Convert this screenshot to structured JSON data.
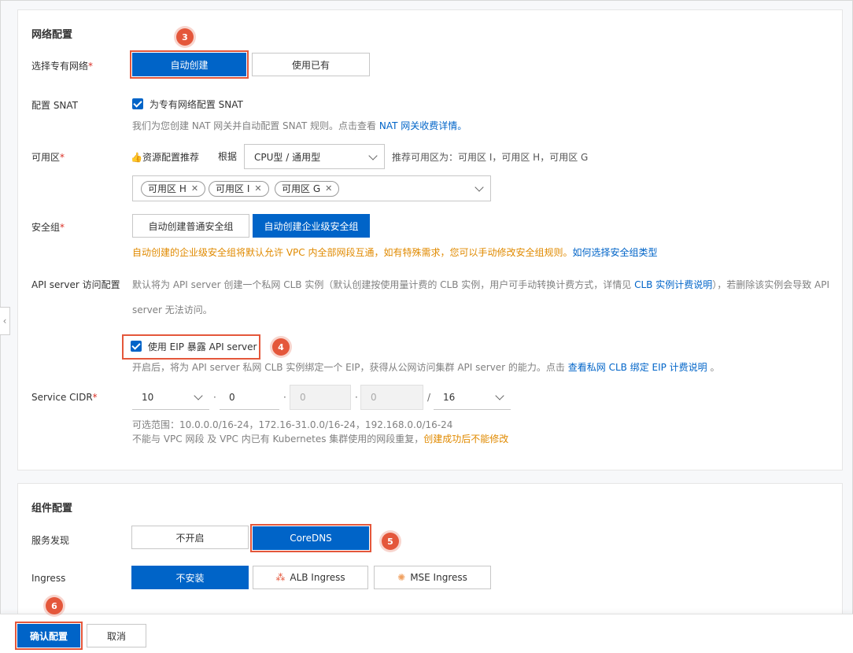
{
  "network": {
    "title": "网络配置",
    "vpc_label": "选择专有网络",
    "vpc_auto": "自动创建",
    "vpc_existing": "使用已有",
    "snat_label": "配置 SNAT",
    "snat_check": "为专有网络配置 SNAT",
    "snat_hint": "我们为您创建 NAT 网关并自动配置 SNAT 规则。点击查看",
    "snat_link": "NAT 网关收费详情。",
    "zone_label": "可用区",
    "zone_recommend": "资源配置推荐",
    "zone_basis": "根据",
    "zone_type": "CPU型 / 通用型",
    "zone_recommend_text": "推荐可用区为：可用区 I，可用区 H，可用区 G",
    "zone_tags": [
      "可用区 H",
      "可用区 I",
      "可用区 G"
    ],
    "sg_label": "安全组",
    "sg_normal": "自动创建普通安全组",
    "sg_enterprise": "自动创建企业级安全组",
    "sg_warn": "自动创建的企业级安全组将默认允许 VPC 内全部网段互通，如有特殊需求，您可以手动修改安全组规则。",
    "sg_link": "如何选择安全组类型",
    "api_label": "API server 访问配置",
    "api_desc_1": "默认将为 API server 创建一个私网 CLB 实例（默认创建按使用量计费的 CLB 实例，用户可手动转换计费方式，详情见",
    "api_desc_link": "CLB 实例计费说明",
    "api_desc_2": "），若删除该实例会导致 API",
    "api_desc_3": "server 无法访问。",
    "eip_check": "使用 EIP 暴露 API server",
    "eip_hint": "开启后，将为 API server 私网 CLB 实例绑定一个 EIP，获得从公网访问集群 API server 的能力。点击",
    "eip_link": "查看私网 CLB 绑定 EIP 计费说明",
    "eip_hint_end": "。",
    "cidr_label": "Service CIDR",
    "cidr_1": "10",
    "cidr_2": "0",
    "cidr_3": "0",
    "cidr_4": "0",
    "cidr_mask": "16",
    "cidr_dot": "·",
    "cidr_slash": "/",
    "cidr_range": "可选范围：10.0.0.0/16-24，172.16-31.0.0/16-24，192.168.0.0/16-24",
    "cidr_note": "不能与 VPC 网段 及 VPC 内已有 Kubernetes 集群使用的网段重复，",
    "cidr_warn": "创建成功后不能修改"
  },
  "components": {
    "title": "组件配置",
    "service_label": "服务发现",
    "service_off": "不开启",
    "service_coredns": "CoreDNS",
    "ingress_label": "Ingress",
    "ingress_none": "不安装",
    "ingress_alb": "ALB Ingress",
    "ingress_mse": "MSE Ingress"
  },
  "footer": {
    "confirm": "确认配置",
    "cancel": "取消"
  },
  "steps": [
    "3",
    "4",
    "5",
    "6"
  ],
  "required_mark": "*",
  "colors": {
    "primary": "#0064c8",
    "highlight": "#e4573b",
    "warning": "#e08a00"
  }
}
